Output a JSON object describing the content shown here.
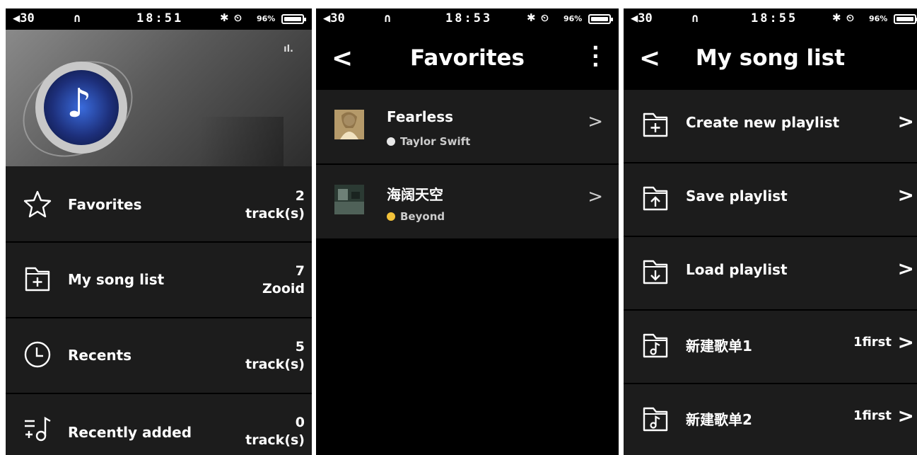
{
  "status": [
    {
      "volume": "◀30",
      "headphones": "∩",
      "time": "18:51",
      "bluetooth": "✱",
      "clock": "⏲",
      "battery": "96%"
    },
    {
      "volume": "◀30",
      "headphones": "∩",
      "time": "18:53",
      "bluetooth": "✱",
      "clock": "⏲",
      "battery": "96%"
    },
    {
      "volume": "◀30",
      "headphones": "∩",
      "time": "18:55",
      "bluetooth": "✱",
      "clock": "⏲",
      "battery": "96%"
    }
  ],
  "battery_level": 0.96,
  "home": {
    "bars_icon": "ıl.",
    "note_icon": "♪",
    "menu": [
      {
        "label": "Favorites",
        "count": "2",
        "unit": "track(s)",
        "icon": "star-icon"
      },
      {
        "label": "My song list",
        "count": "7",
        "unit": "Zooid",
        "icon": "folder-plus-icon"
      },
      {
        "label": "Recents",
        "count": "5",
        "unit": "track(s)",
        "icon": "clock-icon"
      },
      {
        "label": "Recently added",
        "count": "0",
        "unit": "track(s)",
        "icon": "list-add-music-icon"
      }
    ]
  },
  "favorites": {
    "back": "<",
    "title": "Favorites",
    "more": "⋮",
    "songs": [
      {
        "title": "Fearless",
        "artist": "Taylor Swift",
        "dot_color": "#e8e8e8"
      },
      {
        "title": "海阔天空",
        "artist": "Beyond",
        "dot_color": "#f2c23a"
      }
    ],
    "chevron": ">"
  },
  "songlist": {
    "back": "<",
    "title": "My song list",
    "items": [
      {
        "label": "Create new playlist",
        "extra": "",
        "icon": "folder-plus-icon"
      },
      {
        "label": "Save playlist",
        "extra": "",
        "icon": "folder-up-icon"
      },
      {
        "label": "Load playlist",
        "extra": "",
        "icon": "folder-down-icon"
      },
      {
        "label": "新建歌单1",
        "extra": "1first",
        "icon": "folder-music-icon"
      },
      {
        "label": "新建歌单2",
        "extra": "1first",
        "icon": "folder-music-icon"
      }
    ],
    "chevron": ">"
  }
}
